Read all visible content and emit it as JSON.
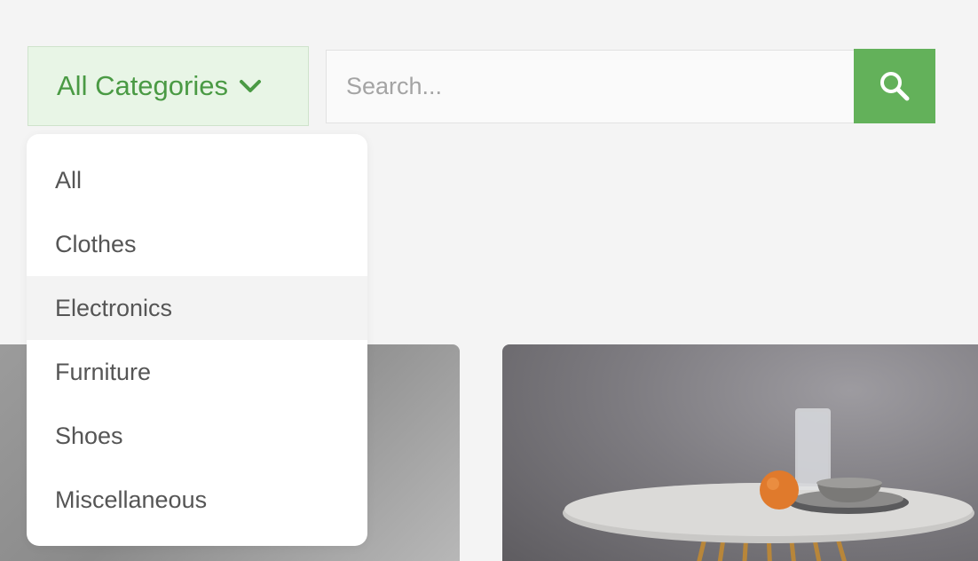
{
  "category_select": {
    "label": "All Categories",
    "chevron_icon": "chevron-down-icon",
    "color": "#4a9a44",
    "background": "#e8f5e6"
  },
  "search": {
    "placeholder": "Search...",
    "value": "",
    "button_icon": "search-icon",
    "button_color": "#63b15a"
  },
  "dropdown": {
    "items": [
      {
        "label": "All"
      },
      {
        "label": "Clothes"
      },
      {
        "label": "Electronics",
        "highlighted": true
      },
      {
        "label": "Furniture"
      },
      {
        "label": "Shoes"
      },
      {
        "label": "Miscellaneous"
      }
    ]
  }
}
